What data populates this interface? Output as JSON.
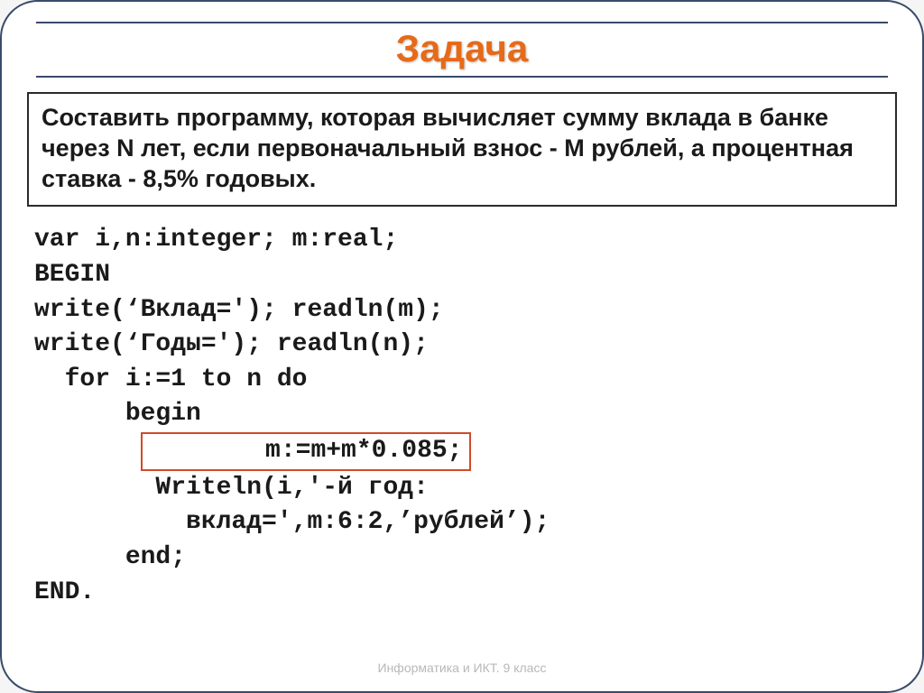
{
  "title": "Задача",
  "problem": "Составить программу, которая вычисляет сумму вклада в банке через N лет, если первоначальный взнос - M рублей, а процентная ставка - 8,5% годовых.",
  "code": {
    "l1": "var i,n:integer; m:real;",
    "l2": "BEGIN",
    "l3": "write(‘Вклад='); readln(m);",
    "l4": "write(‘Годы='); readln(n);",
    "l5": "  for i:=1 to n do",
    "l6": "      begin",
    "l7": "        m:=m+m*0.085;",
    "l8": "        Writeln(i,'-й год:",
    "l9": "          вклад=',m:6:2,’рублей’);",
    "l10": "      end;",
    "l11": "END."
  },
  "footer": "Информатика и ИКТ. 9 класс"
}
